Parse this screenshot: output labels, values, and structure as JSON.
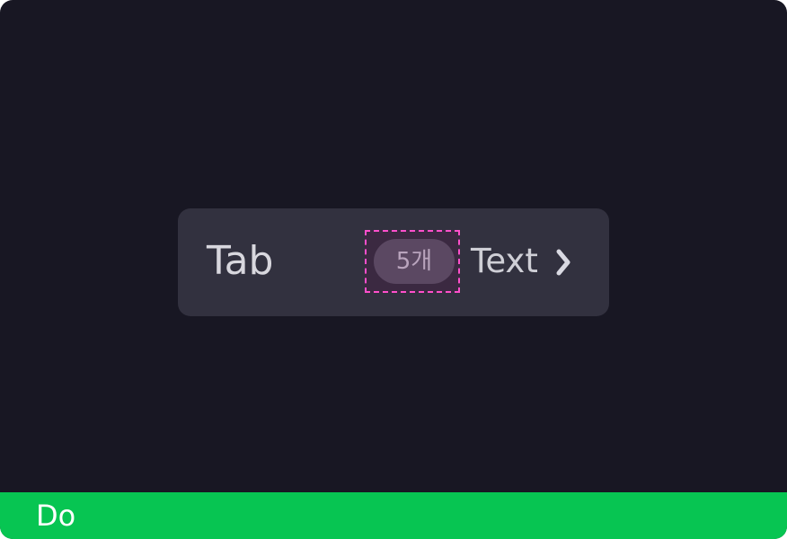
{
  "tab": {
    "title": "Tab",
    "count_badge": "5개",
    "action_text": "Text",
    "action_icon": "chevron-right-icon"
  },
  "footer": {
    "label": "Do"
  },
  "colors": {
    "background": "#181723",
    "tab_surface": "#32313f",
    "highlight_border": "#ff4fcb",
    "badge_fill": "#5b4862",
    "footer_green": "#07c552"
  }
}
